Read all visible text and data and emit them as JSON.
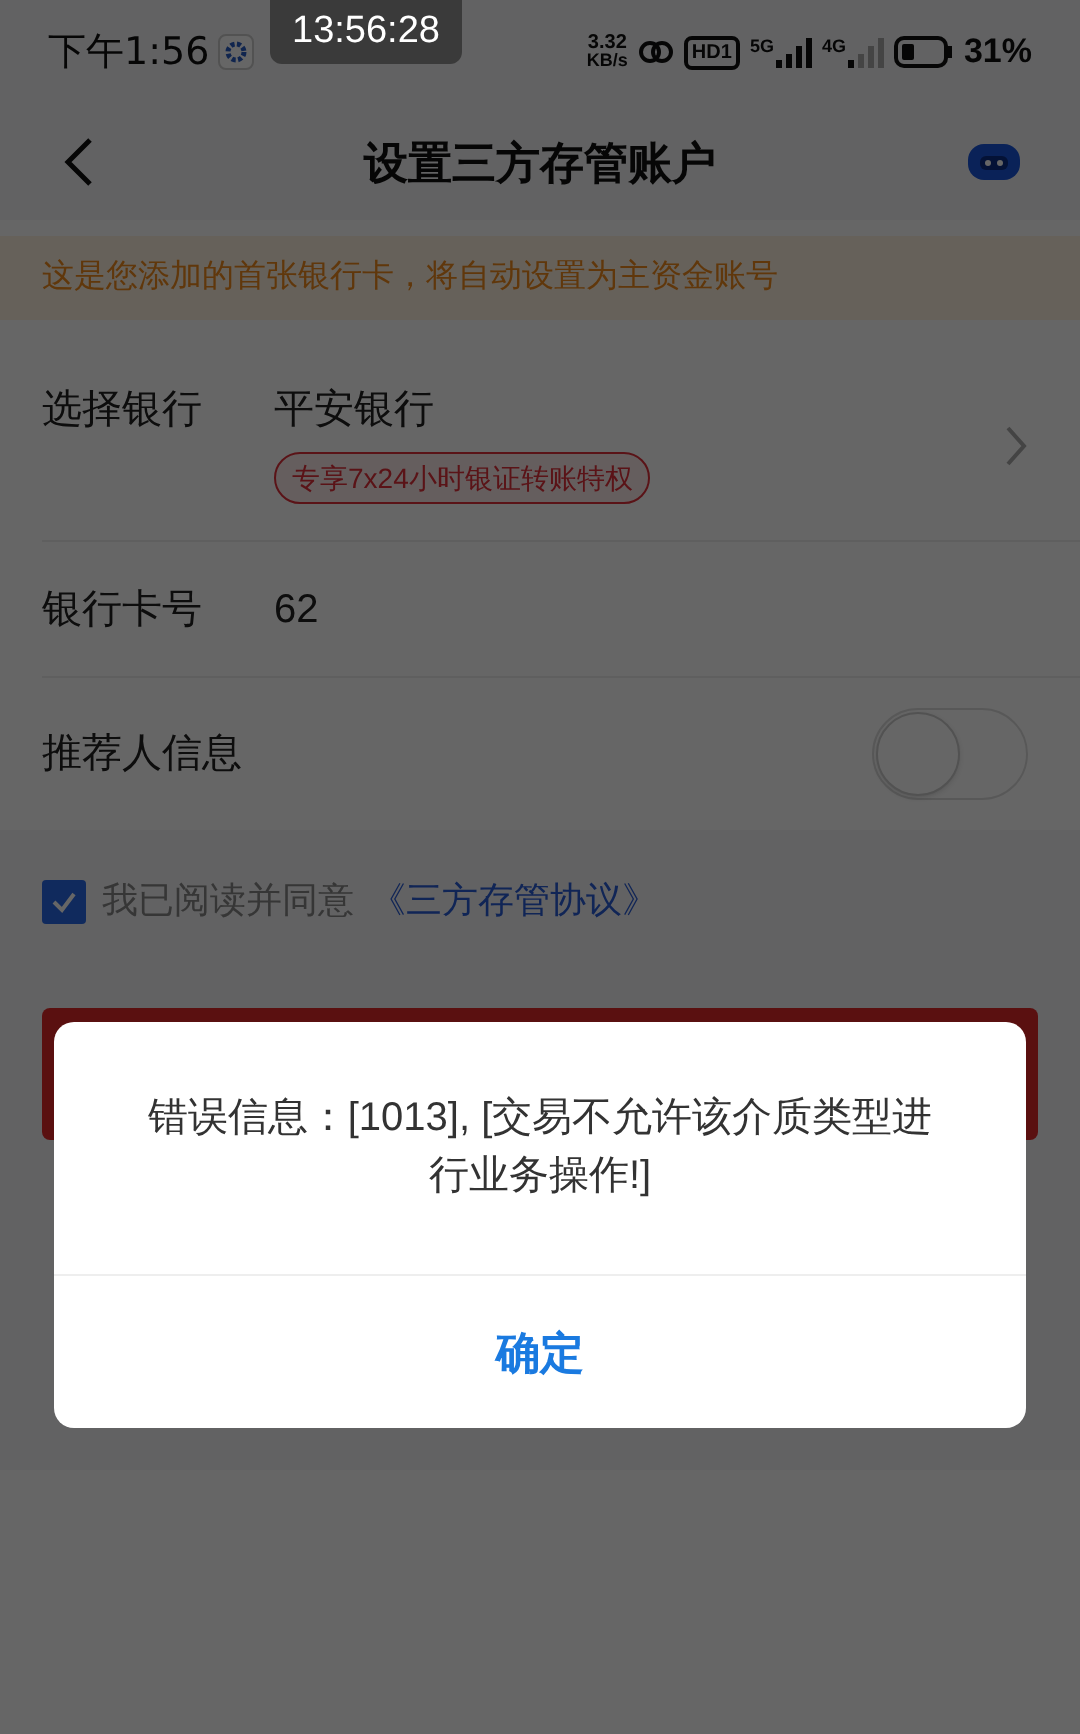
{
  "status_bar": {
    "time": "下午1:56",
    "clock_toast": "13:56:28",
    "net_speed_value": "3.32",
    "net_speed_unit": "KB/s",
    "hd_badge": "HD1",
    "sim1": "5G",
    "sim2": "4G",
    "battery": "31%"
  },
  "header": {
    "title": "设置三方存管账户"
  },
  "notice": "这是您添加的首张银行卡，将自动设置为主资金账号",
  "form_rows": [
    {
      "kind": "select",
      "label": "选择银行",
      "value": "平安银行",
      "tag": "专享7x24小时银证转账特权"
    },
    {
      "kind": "input",
      "label": "银行卡号",
      "value": "62"
    },
    {
      "kind": "toggle",
      "label": "推荐人信息",
      "on": false
    }
  ],
  "agreement": {
    "checked": true,
    "text": "我已阅读并同意",
    "link": "《三方存管协议》"
  },
  "dialog": {
    "message": "错误信息：[1013], [交易不允许该介质类型进行业务操作!]",
    "button": "确定"
  }
}
